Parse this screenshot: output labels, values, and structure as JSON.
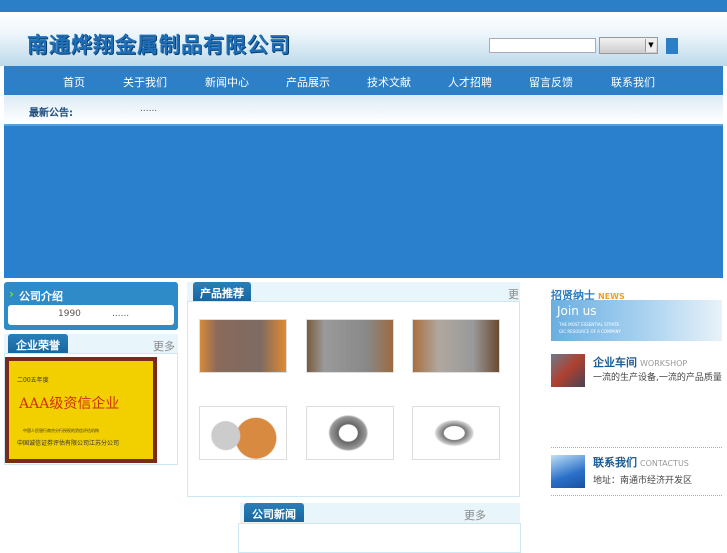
{
  "header": {
    "title": "南通烨翔金属制品有限公司",
    "search_value": "",
    "select_value": ""
  },
  "nav": [
    "首页",
    "关于我们",
    "新闻中心",
    "产品展示",
    "技术文献",
    "人才招聘",
    "留言反馈",
    "联系我们"
  ],
  "notice": {
    "label": "最新公告:",
    "text": "......"
  },
  "intro": {
    "title": "公司介绍",
    "year": "1990",
    "text": "......"
  },
  "honor": {
    "title": "企业荣誉",
    "more": "更多",
    "cert_year": "二00五年度",
    "cert_title": "AAA级资信企业",
    "cert_small": "中国人民银行南京分行授权的资信评估机构",
    "cert_issuer": "中国诚信证券评估有限公司江苏分公司"
  },
  "products": {
    "title": "产品推荐",
    "more": "更多"
  },
  "news": {
    "title": "公司新闻",
    "more": "更多"
  },
  "right": {
    "recruit_title": "招贤纳士",
    "recruit_en": "NEWS",
    "join_title": "Join us",
    "join_sub1": "THE MOST ESSENTIAL STRATE-",
    "join_sub2": "GIC RESOURCE OF A COMPANY",
    "workshop_title": "企业车间",
    "workshop_en": "WORKSHOP",
    "workshop_text": "一流的生产设备,一流的产品质量",
    "contact_title": "联系我们",
    "contact_en": "CONTACTUS",
    "contact_text": "地址：南通市经济开发区"
  },
  "colors": {
    "brand": "#2a7fc6",
    "title": "#1f6fb8"
  }
}
